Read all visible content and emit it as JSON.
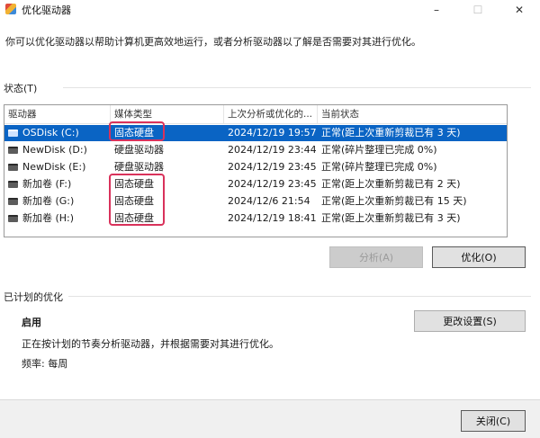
{
  "window": {
    "title": "优化驱动器",
    "controls": {
      "minimize": "–",
      "maximize": "☐",
      "close": "✕"
    }
  },
  "description": "你可以优化驱动器以帮助计算机更高效地运行，或者分析驱动器以了解是否需要对其进行优化。",
  "status_section": {
    "label": "状态(T)",
    "columns": [
      "驱动器",
      "媒体类型",
      "上次分析或优化的...",
      "当前状态"
    ],
    "rows": [
      {
        "name": "OSDisk (C:)",
        "media": "固态硬盘",
        "last": "2024/12/19 19:57",
        "status": "正常(距上次重新剪裁已有 3 天)",
        "selected": true
      },
      {
        "name": "NewDisk (D:)",
        "media": "硬盘驱动器",
        "last": "2024/12/19 23:44",
        "status": "正常(碎片整理已完成 0%)",
        "selected": false
      },
      {
        "name": "NewDisk (E:)",
        "media": "硬盘驱动器",
        "last": "2024/12/19 23:45",
        "status": "正常(碎片整理已完成 0%)",
        "selected": false
      },
      {
        "name": "新加卷 (F:)",
        "media": "固态硬盘",
        "last": "2024/12/19 23:45",
        "status": "正常(距上次重新剪裁已有 2 天)",
        "selected": false
      },
      {
        "name": "新加卷 (G:)",
        "media": "固态硬盘",
        "last": "2024/12/6 21:54",
        "status": "正常(距上次重新剪裁已有 15 天)",
        "selected": false
      },
      {
        "name": "新加卷 (H:)",
        "media": "固态硬盘",
        "last": "2024/12/19 18:41",
        "status": "正常(距上次重新剪裁已有 3 天)",
        "selected": false
      }
    ]
  },
  "buttons": {
    "analyze": "分析(A)",
    "optimize": "优化(O)",
    "change_settings": "更改设置(S)",
    "close": "关闭(C)"
  },
  "scheduled_section": {
    "label": "已计划的优化",
    "state": "启用",
    "description": "正在按计划的节奏分析驱动器，并根据需要对其进行优化。",
    "frequency": "频率: 每周"
  },
  "colors": {
    "selection": "#0a64c4",
    "highlight_box": "#d9325b"
  }
}
